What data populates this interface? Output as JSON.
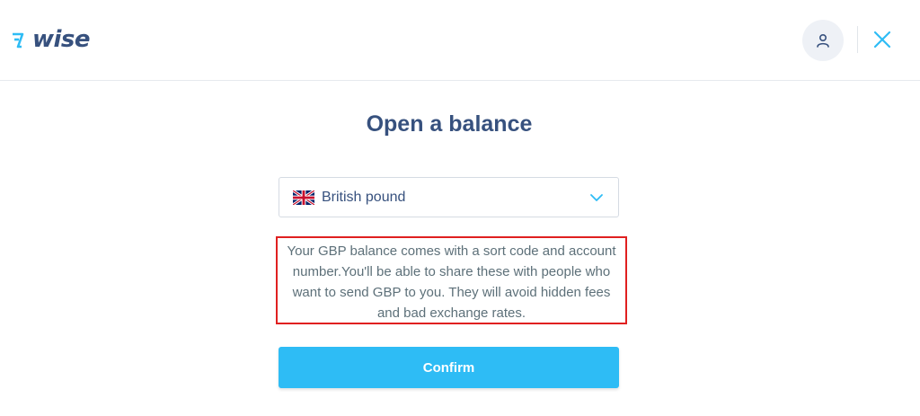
{
  "header": {
    "logo_text": "wise",
    "logo_icon": "wise-flag-icon",
    "profile_icon": "user-icon",
    "close_icon": "close-icon"
  },
  "main": {
    "title": "Open a balance",
    "currency_select": {
      "flag_icon": "uk-flag-icon",
      "selected_value": "British pound",
      "chevron_icon": "chevron-down-icon"
    },
    "info_text": "Your GBP balance comes with a sort code and account number.You'll be able to share these with people who want to send GBP to you. They will avoid hidden fees and bad exchange rates.",
    "confirm_label": "Confirm"
  },
  "colors": {
    "brand_navy": "#37517e",
    "accent_blue": "#2ebcf5",
    "highlight_red": "#e02020"
  }
}
